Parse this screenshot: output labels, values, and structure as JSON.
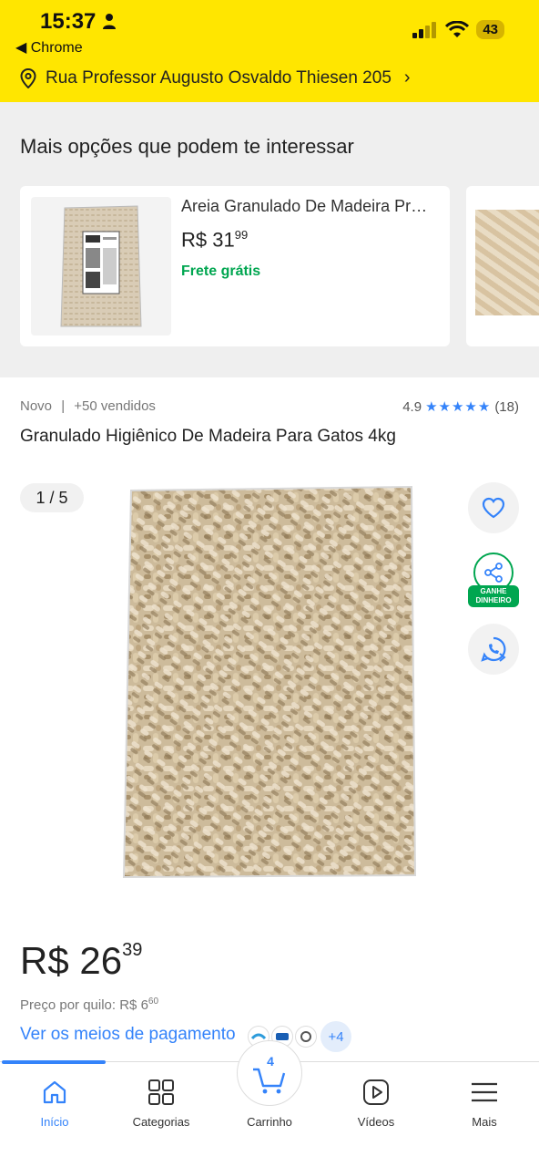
{
  "status_bar": {
    "time": "15:37",
    "back_app": "◀ Chrome",
    "battery": "43"
  },
  "header": {
    "address": "Rua Professor Augusto Osvaldo Thiesen 205"
  },
  "suggestions": {
    "title": "Mais opções que podem te interessar",
    "items": [
      {
        "title": "Areia Granulado De Madeira Pr…",
        "price_int": "R$ 31",
        "price_cents": "99",
        "shipping": "Frete grátis"
      }
    ]
  },
  "product": {
    "condition": "Novo",
    "separator": "|",
    "sold": "+50 vendidos",
    "rating": "4.9",
    "stars": "★★★★★",
    "reviews": "(18)",
    "title": "Granulado Higiênico De Madeira Para Gatos 4kg",
    "image_counter": "1 / 5",
    "share_label_line1": "GANHE",
    "share_label_line2": "DINHEIRO",
    "price_int": "R$ 26",
    "price_cents": "39",
    "price_per_kg_label": "Preço por quilo: R$ 6",
    "price_per_kg_cents": "60",
    "payment_link": "Ver os meios de pagamento",
    "payment_more": "+4"
  },
  "bottom_nav": {
    "items": [
      {
        "label": "Início",
        "icon": "home-icon"
      },
      {
        "label": "Categorias",
        "icon": "grid-icon"
      },
      {
        "label": "Carrinho",
        "icon": "cart-icon"
      },
      {
        "label": "Vídeos",
        "icon": "play-icon"
      },
      {
        "label": "Mais",
        "icon": "menu-icon"
      }
    ],
    "cart_count": "4"
  },
  "colors": {
    "brand_yellow": "#ffe600",
    "accent_blue": "#3483fa",
    "green": "#00a650"
  }
}
